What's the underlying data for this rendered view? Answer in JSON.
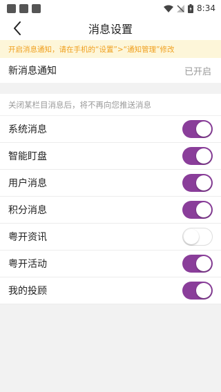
{
  "status_bar": {
    "time": "8:34"
  },
  "header": {
    "title": "消息设置"
  },
  "notice": {
    "text": "开启消息通知，请在手机的“设置”>“通知管理”修改"
  },
  "new_message": {
    "label": "新消息通知",
    "value": "已开启"
  },
  "hint": {
    "text": "关闭某栏目消息后，将不再向您推送消息"
  },
  "items": [
    {
      "label": "系统消息",
      "enabled": true
    },
    {
      "label": "智能盯盘",
      "enabled": true
    },
    {
      "label": "用户消息",
      "enabled": true
    },
    {
      "label": "积分消息",
      "enabled": true
    },
    {
      "label": "粤开资讯",
      "enabled": false
    },
    {
      "label": "粤开活动",
      "enabled": true
    },
    {
      "label": "我的投顾",
      "enabled": true
    }
  ],
  "colors": {
    "accent": "#8a3e9a",
    "notice_text": "#f0a020",
    "notice_bg": "#fdf6d9"
  }
}
